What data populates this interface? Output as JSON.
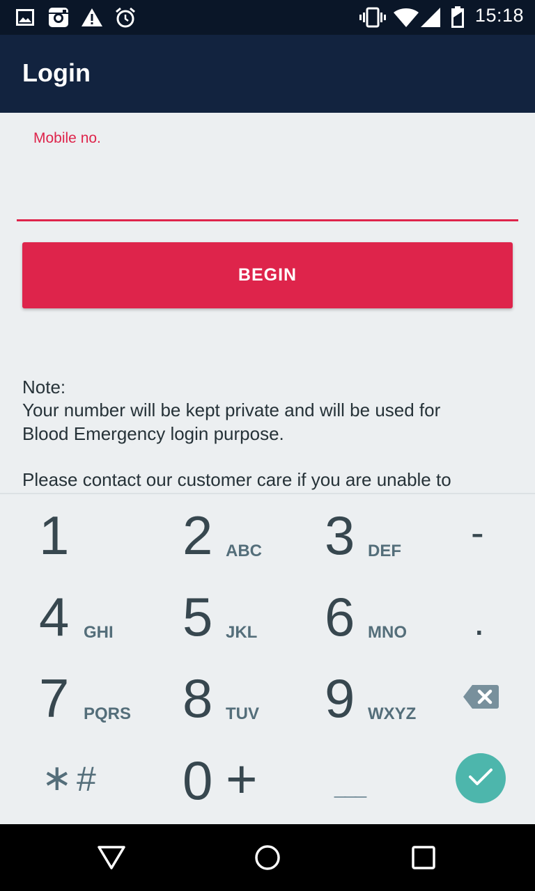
{
  "status_bar": {
    "time": "15:18",
    "left_icons": [
      "image-icon",
      "instagram-icon",
      "warning-icon",
      "alarm-icon"
    ],
    "right_icons": [
      "vibrate-icon",
      "wifi-icon",
      "signal-icon",
      "battery-icon"
    ]
  },
  "app_bar": {
    "title": "Login"
  },
  "form": {
    "mobile_label": "Mobile no.",
    "mobile_value": "",
    "begin_label": "BEGIN"
  },
  "note": {
    "heading": "Note:",
    "line1": "Your number will be kept private and will be used for",
    "line2": "Blood Emergency login purpose.",
    "line3": "Please contact our customer care if you are unable to"
  },
  "keypad": {
    "keys": [
      {
        "digit": "1",
        "letters": ""
      },
      {
        "digit": "2",
        "letters": "ABC"
      },
      {
        "digit": "3",
        "letters": "DEF"
      },
      {
        "digit": "4",
        "letters": "GHI"
      },
      {
        "digit": "5",
        "letters": "JKL"
      },
      {
        "digit": "6",
        "letters": "MNO"
      },
      {
        "digit": "7",
        "letters": "PQRS"
      },
      {
        "digit": "8",
        "letters": "TUV"
      },
      {
        "digit": "9",
        "letters": "WXYZ"
      },
      {
        "digit": "0",
        "letters": "+"
      }
    ],
    "dash": "-",
    "dot": ".",
    "star": "∗",
    "hash": "#",
    "space": "___",
    "backspace_icon": "backspace-icon",
    "done_icon": "check-icon"
  },
  "nav_bar": {
    "icons": [
      "back-icon",
      "home-icon",
      "recents-icon"
    ]
  },
  "colors": {
    "accent": "#DE244B",
    "app_bar": "#12233F",
    "status_bar": "#0A1628",
    "done": "#4DB6AC"
  }
}
